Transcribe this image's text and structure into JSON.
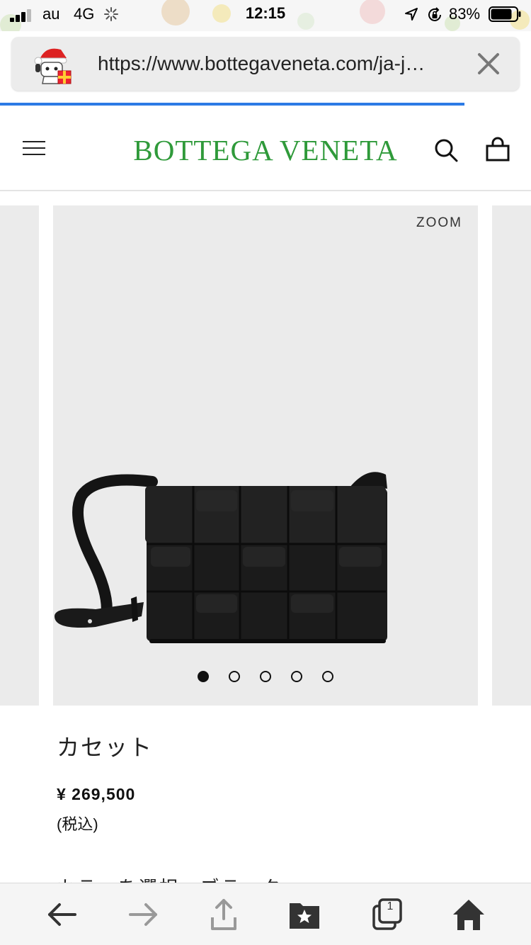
{
  "status_bar": {
    "carrier": "au",
    "network": "4G",
    "time": "12:15",
    "battery": "83%",
    "battery_level": 0.83
  },
  "url_bar": {
    "url": "https://www.bottegaveneta.com/ja-j…"
  },
  "page_load_progress": 0.875,
  "header": {
    "brand": "BOTTEGA VENETA"
  },
  "gallery": {
    "zoom_label": "ZOOM",
    "slide_count": 5,
    "active_slide": 1
  },
  "product": {
    "name": "カセット",
    "price": "¥ 269,500",
    "tax_note": "(税込)",
    "partial_text": "カラーを選択　ブラック"
  },
  "colors": {
    "brand_green": "#2f9a3a",
    "progress_blue": "#2c7be5",
    "gallery_bg": "#ebebeb"
  },
  "toolbar": {
    "tab_count": "1",
    "icons": [
      "back-arrow-icon",
      "forward-arrow-icon",
      "share-icon",
      "bookmarks-icon",
      "tabs-icon",
      "home-icon"
    ]
  }
}
